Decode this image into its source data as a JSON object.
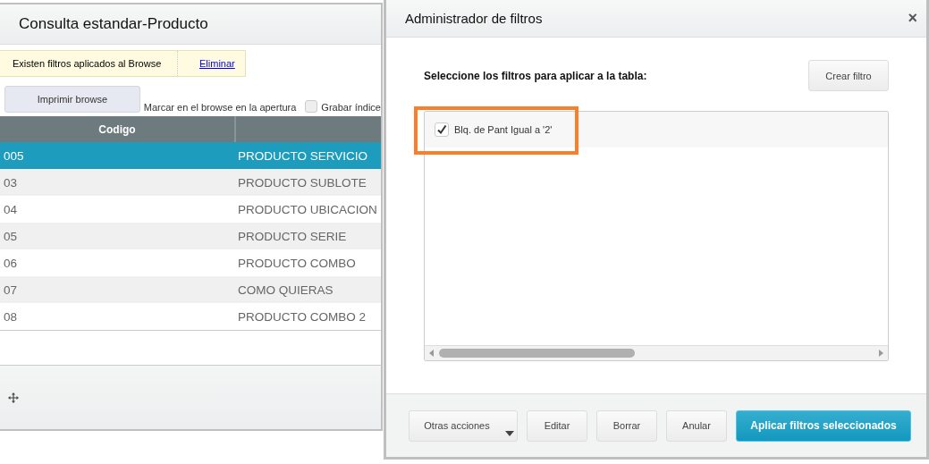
{
  "main_window": {
    "title": "Consulta estandar-Producto",
    "notice": {
      "text": "Existen filtros aplicados al Browse",
      "link": "Eliminar"
    },
    "print_button": "Imprimir browse",
    "options": [
      {
        "label": "Marcar en el browse en la apertura",
        "kind": "text"
      },
      {
        "label": "Grabar índice",
        "kind": "checkbox",
        "checked": false
      }
    ],
    "table": {
      "columns": [
        "Codigo"
      ],
      "rows": [
        {
          "code": "005",
          "name": "PRODUCTO SERVICIO",
          "selected": true
        },
        {
          "code": "03",
          "name": "PRODUCTO SUBLOTE",
          "selected": false
        },
        {
          "code": "04",
          "name": "PRODUCTO UBICACION",
          "selected": false
        },
        {
          "code": "05",
          "name": "PRODUCTO SERIE",
          "selected": false
        },
        {
          "code": "06",
          "name": "PRODUCTO COMBO",
          "selected": false
        },
        {
          "code": "07",
          "name": "COMO QUIERAS",
          "selected": false
        },
        {
          "code": "08",
          "name": "PRODUCTO COMBO 2",
          "selected": false
        }
      ]
    }
  },
  "dialog": {
    "title": "Administrador de filtros",
    "close": "×",
    "prompt": "Seleccione los filtros para aplicar a la tabla:",
    "create_button": "Crear filtro",
    "filters": [
      {
        "label": "Blq. de Pant Igual a '2'",
        "checked": true,
        "highlighted": true
      }
    ],
    "buttons": [
      {
        "label": "Otras acciones",
        "kind": "menu"
      },
      {
        "label": "Editar",
        "kind": "plain"
      },
      {
        "label": "Borrar",
        "kind": "plain"
      },
      {
        "label": "Anular",
        "kind": "plain"
      },
      {
        "label": "Aplicar filtros seleccionados",
        "kind": "primary"
      }
    ]
  }
}
